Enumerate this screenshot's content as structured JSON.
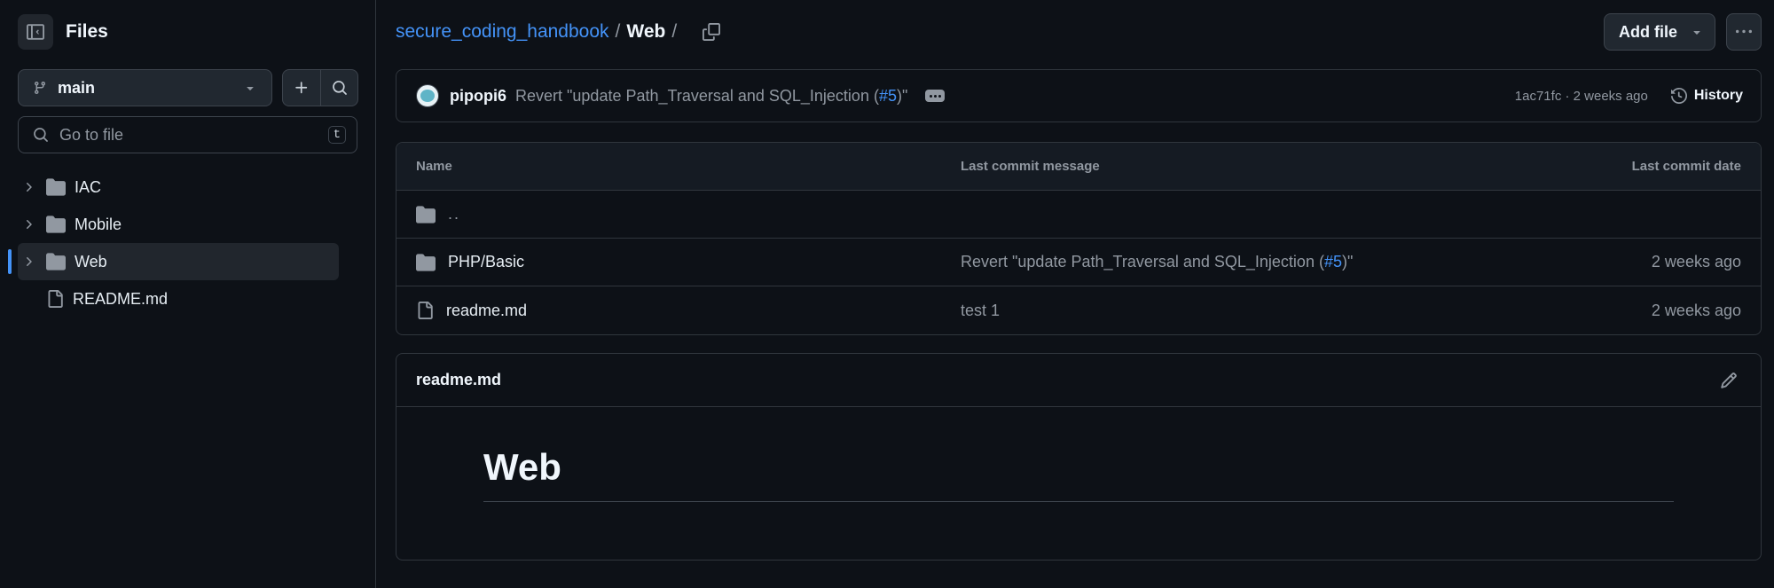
{
  "sidebar": {
    "title": "Files",
    "branch": "main",
    "goto_placeholder": "Go to file",
    "goto_shortcut": "t",
    "tree": [
      {
        "label": "IAC",
        "type": "folder",
        "active": false
      },
      {
        "label": "Mobile",
        "type": "folder",
        "active": false
      },
      {
        "label": "Web",
        "type": "folder",
        "active": true
      },
      {
        "label": "README.md",
        "type": "file",
        "active": false
      }
    ]
  },
  "breadcrumb": {
    "repo": "secure_coding_handbook",
    "sep1": "/",
    "current": "Web",
    "sep2": "/"
  },
  "actions": {
    "add_file": "Add file"
  },
  "latest_commit": {
    "author": "pipopi6",
    "message_prefix": "Revert \"update Path_Traversal and SQL_Injection (",
    "pr_ref": "#5",
    "message_suffix": ")\"",
    "meta": "1ac71fc · 2 weeks ago",
    "history_label": "History"
  },
  "files_table": {
    "headers": {
      "name": "Name",
      "message": "Last commit message",
      "date": "Last commit date"
    },
    "parent": "..",
    "rows": [
      {
        "name": "PHP/Basic",
        "type": "folder",
        "msg_prefix": "Revert \"update Path_Traversal and SQL_Injection (",
        "pr_ref": "#5",
        "msg_suffix": ")\"",
        "date": "2 weeks ago"
      },
      {
        "name": "readme.md",
        "type": "file",
        "msg_prefix": "test 1",
        "pr_ref": "",
        "msg_suffix": "",
        "date": "2 weeks ago"
      }
    ]
  },
  "readme": {
    "title": "readme.md",
    "heading": "Web"
  },
  "colors": {
    "background": "#0d1117",
    "border": "#30363d",
    "link": "#4493f8",
    "muted": "#9198a1",
    "text": "#e6edf3"
  }
}
